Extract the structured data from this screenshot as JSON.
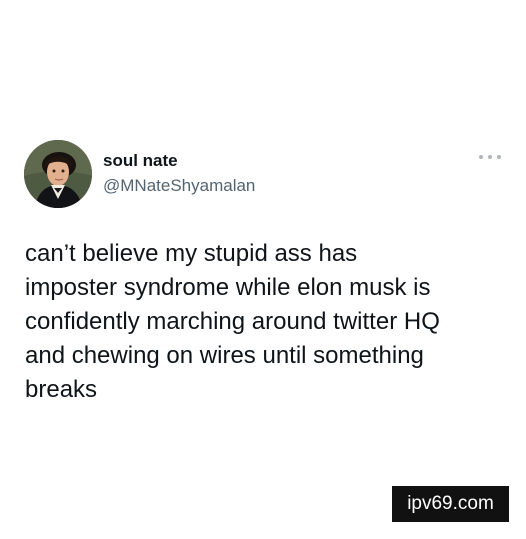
{
  "tweet": {
    "display_name": "soul nate",
    "handle": "@MNateShyamalan",
    "text": "can’t believe my stupid ass has\nimposter syndrome while elon musk is\nconfidently marching around twitter HQ\nand chewing on wires until something\nbreaks",
    "avatar_icon": "portrait-avatar-icon",
    "more_icon": "more-options-icon"
  },
  "watermark": {
    "text": "ipv69.com"
  },
  "colors": {
    "background": "#ffffff",
    "primary_text": "#0f1419",
    "secondary_text": "#536471",
    "watermark_bg": "#111111",
    "watermark_text": "#ffffff"
  }
}
